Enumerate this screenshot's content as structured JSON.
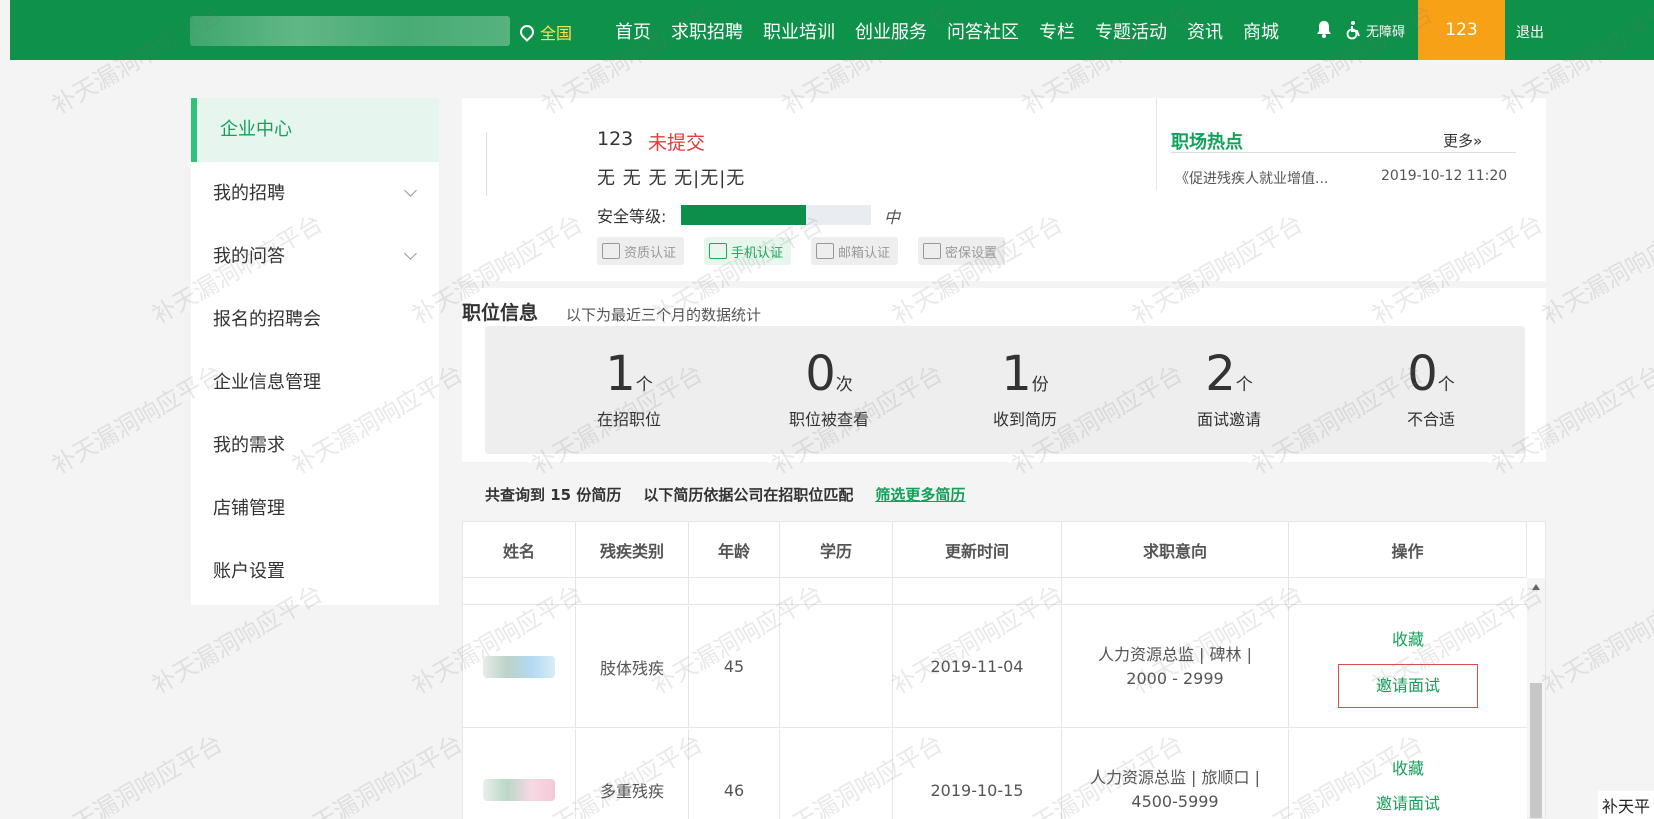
{
  "header": {
    "location": "全国",
    "nav": [
      "首页",
      "求职招聘",
      "职业培训",
      "创业服务",
      "问答社区",
      "专栏",
      "专题活动",
      "资讯",
      "商城"
    ],
    "accessibility": "无障碍",
    "user": "123",
    "logout": "退出"
  },
  "sidebar": {
    "active": "企业中心",
    "items": [
      {
        "label": "我的招聘",
        "expandable": true
      },
      {
        "label": "我的问答",
        "expandable": true
      },
      {
        "label": "报名的招聘会",
        "expandable": false
      },
      {
        "label": "企业信息管理",
        "expandable": false
      },
      {
        "label": "我的需求",
        "expandable": false
      },
      {
        "label": "店铺管理",
        "expandable": false
      },
      {
        "label": "账户设置",
        "expandable": false
      }
    ]
  },
  "profile": {
    "name": "123",
    "status": "未提交",
    "info": "无  无  无  无|无|无",
    "security_label": "安全等级:",
    "security_level": "中",
    "security_progress": 0.66,
    "badges": [
      "资质认证",
      "手机认证",
      "邮箱认证",
      "密保设置"
    ]
  },
  "hot": {
    "title": "职场热点",
    "more": "更多»",
    "item": "《促进残疾人就业增值...",
    "date": "2019-10-12 11:20"
  },
  "stats": {
    "title": "职位信息",
    "subtitle": "以下为最近三个月的数据统计",
    "items": [
      {
        "num": "1",
        "unit": "个",
        "label": "在招职位"
      },
      {
        "num": "0",
        "unit": "次",
        "label": "职位被查看"
      },
      {
        "num": "1",
        "unit": "份",
        "label": "收到简历"
      },
      {
        "num": "2",
        "unit": "个",
        "label": "面试邀请"
      },
      {
        "num": "0",
        "unit": "个",
        "label": "不合适"
      }
    ]
  },
  "summary": {
    "count": "共查询到 15 份简历",
    "note": "以下简历依据公司在招职位匹配",
    "link": "筛选更多简历"
  },
  "table": {
    "headers": [
      "姓名",
      "残疾类别",
      "年龄",
      "学历",
      "更新时间",
      "求职意向",
      "操作"
    ],
    "rows": [
      {
        "category": "肢体残疾",
        "age": "45",
        "edu": "",
        "updated": "2019-11-04",
        "intent": "人力资源总监 | 碑林 | 2000 - 2999",
        "fav": "收藏",
        "invite": "邀请面试"
      },
      {
        "category": "多重残疾",
        "age": "46",
        "edu": "",
        "updated": "2019-10-15",
        "intent": "人力资源总监 | 旅顺口 | 4500-5999",
        "fav": "收藏",
        "invite": "邀请面试"
      }
    ]
  },
  "watermark": "补天漏洞响应平台",
  "corner": "补天平"
}
